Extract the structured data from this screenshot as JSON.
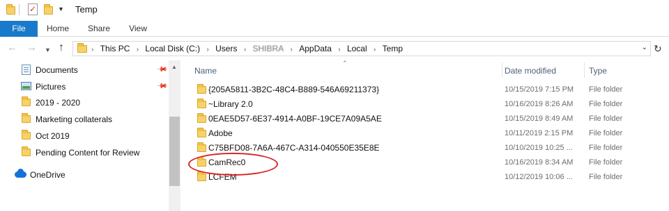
{
  "window": {
    "title": "Temp"
  },
  "ribbon": {
    "tabs": [
      "File",
      "Home",
      "Share",
      "View"
    ]
  },
  "address": {
    "crumbs": [
      "This PC",
      "Local Disk (C:)",
      "Users",
      "SHIBRA",
      "AppData",
      "Local",
      "Temp"
    ]
  },
  "sidebar": {
    "items": [
      {
        "label": "Documents",
        "icon": "documents-icon",
        "pinned": true
      },
      {
        "label": "Pictures",
        "icon": "pictures-icon",
        "pinned": true
      },
      {
        "label": "2019 - 2020",
        "icon": "folder-icon",
        "pinned": false
      },
      {
        "label": "Marketing collaterals",
        "icon": "folder-icon",
        "pinned": false
      },
      {
        "label": "Oct 2019",
        "icon": "folder-icon",
        "pinned": false
      },
      {
        "label": "Pending Content for Review",
        "icon": "folder-icon",
        "pinned": false
      }
    ],
    "onedrive": "OneDrive"
  },
  "filelist": {
    "columns": {
      "name": "Name",
      "date": "Date modified",
      "type": "Type"
    },
    "rows": [
      {
        "name": "{205A5811-3B2C-48C4-B889-546A69211373}",
        "date": "10/15/2019 7:15 PM",
        "type": "File folder"
      },
      {
        "name": "~Library 2.0",
        "date": "10/16/2019 8:26 AM",
        "type": "File folder"
      },
      {
        "name": "0EAE5D57-6E37-4914-A0BF-19CE7A09A5AE",
        "date": "10/15/2019 8:49 AM",
        "type": "File folder"
      },
      {
        "name": "Adobe",
        "date": "10/11/2019 2:15 PM",
        "type": "File folder"
      },
      {
        "name": "C75BFD08-7A6A-467C-A314-040550E35E8E",
        "date": "10/10/2019 10:25 ...",
        "type": "File folder"
      },
      {
        "name": "CamRec0",
        "date": "10/16/2019 8:34 AM",
        "type": "File folder"
      },
      {
        "name": "LCFEM",
        "date": "10/12/2019 10:06 ...",
        "type": "File folder"
      }
    ]
  },
  "colors": {
    "file_tab": "#1979ca",
    "folder": "#f7d26b",
    "highlight": "#d62424",
    "onedrive": "#1473d8"
  }
}
